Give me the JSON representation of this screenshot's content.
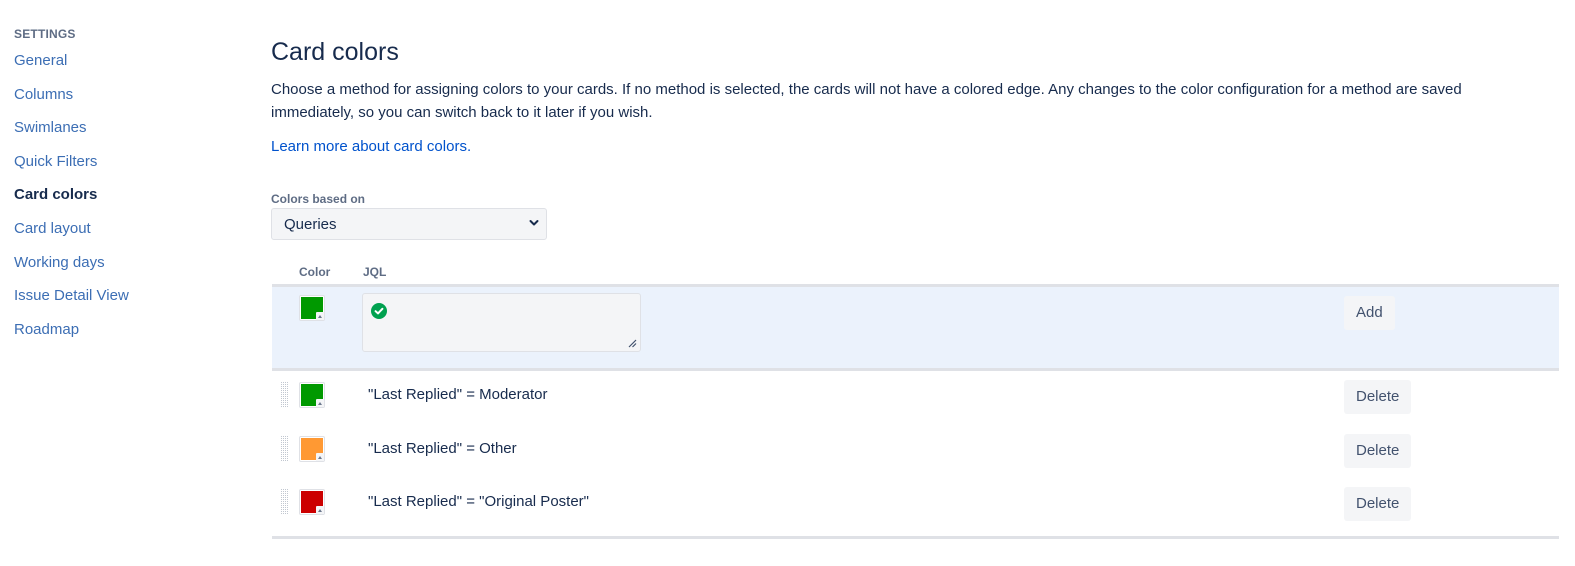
{
  "sidebar": {
    "heading": "SETTINGS",
    "items": [
      {
        "label": "General",
        "active": false
      },
      {
        "label": "Columns",
        "active": false
      },
      {
        "label": "Swimlanes",
        "active": false
      },
      {
        "label": "Quick Filters",
        "active": false
      },
      {
        "label": "Card colors",
        "active": true
      },
      {
        "label": "Card layout",
        "active": false
      },
      {
        "label": "Working days",
        "active": false
      },
      {
        "label": "Issue Detail View",
        "active": false
      },
      {
        "label": "Roadmap",
        "active": false
      }
    ]
  },
  "main": {
    "title": "Card colors",
    "description": "Choose a method for assigning colors to your cards. If no method is selected, the cards will not have a colored edge. Any changes to the color configuration for a method are saved immediately, so you can switch back to it later if you wish.",
    "learn_more_link": "Learn more about card colors.",
    "colors_based_on": {
      "label": "Colors based on",
      "selected": "Queries"
    },
    "table": {
      "headers": {
        "color": "Color",
        "jql": "JQL"
      },
      "add_row": {
        "color": "#009900",
        "jql_value": "",
        "validation_icon": "check-circle-icon",
        "add_label": "Add"
      },
      "rules": [
        {
          "color": "#009900",
          "jql": "\"Last Replied\" = Moderator",
          "delete_label": "Delete"
        },
        {
          "color": "#ff9933",
          "jql": "\"Last Replied\" = Other",
          "delete_label": "Delete"
        },
        {
          "color": "#cc0000",
          "jql": "\"Last Replied\" = \"Original Poster\"",
          "delete_label": "Delete"
        }
      ]
    }
  },
  "colors": {
    "link": "#0052cc",
    "nav_link": "#3c6eb4",
    "valid_green": "#00a150",
    "add_row_bg": "#ebf2fc"
  }
}
